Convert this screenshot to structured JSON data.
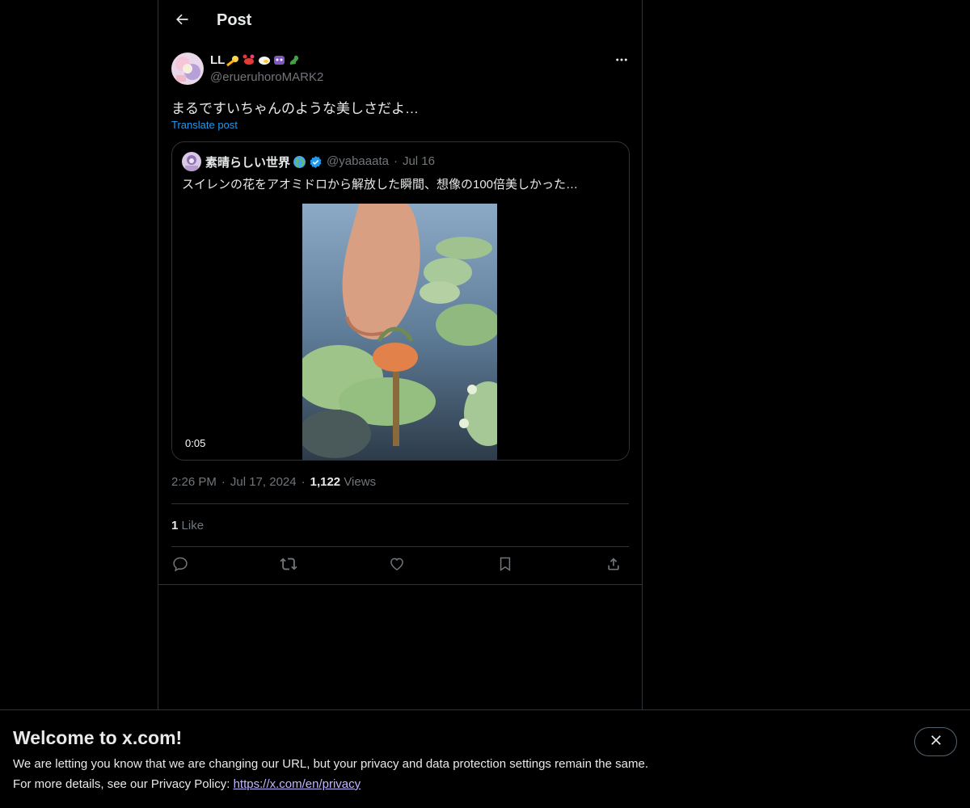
{
  "header": {
    "title": "Post"
  },
  "post": {
    "author_name": "LL",
    "author_emojis": [
      "comet-emoji",
      "crab-emoji",
      "tooth-emoji",
      "alien-emoji",
      "dragon-emoji"
    ],
    "author_handle": "@erueruhoroMARK2",
    "text": "まるですいちゃんのような美しさだよ…",
    "translate_label": "Translate post",
    "time": "2:26 PM",
    "date": "Jul 17, 2024",
    "views_count": "1,122",
    "views_label": "Views",
    "likes_count": "1",
    "likes_label": "Like"
  },
  "quote": {
    "author_name": "素晴らしい世界",
    "author_handle": "@yabaaata",
    "date": "Jul 16",
    "text": "スイレンの花をアオミドロから解放した瞬間、想像の100倍美しかった…",
    "video_time": "0:05"
  },
  "banner": {
    "title": "Welcome to x.com!",
    "line1": "We are letting you know that we are changing our URL, but your privacy and data protection settings remain the same.",
    "line2_prefix": "For more details, see our Privacy Policy: ",
    "link": "https://x.com/en/privacy"
  },
  "colors": {
    "accent": "#1d9bf0",
    "background": "#000000",
    "border": "#2f3336",
    "muted_text": "#71767b",
    "link_visited": "#c4b5fd"
  }
}
